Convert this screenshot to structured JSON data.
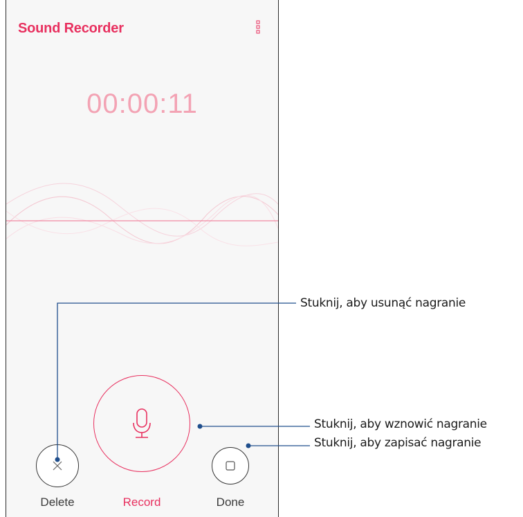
{
  "app": {
    "title": "Sound Recorder",
    "menu_icon": "more-vertical-icon"
  },
  "recorder": {
    "elapsed_time": "00:00:11"
  },
  "controls": {
    "delete_label": "Delete",
    "record_label": "Record",
    "done_label": "Done",
    "delete_icon": "close-icon",
    "record_icon": "microphone-icon",
    "done_icon": "stop-icon"
  },
  "callouts": {
    "delete_hint": "Stuknij, aby usunąć nagranie",
    "record_hint": "Stuknij, aby wznowić nagranie",
    "done_hint": "Stuknij, aby zapisać nagranie"
  },
  "colors": {
    "accent": "#e8305f",
    "timer": "#f3a3b4",
    "callout_line": "#1f4e8c"
  }
}
